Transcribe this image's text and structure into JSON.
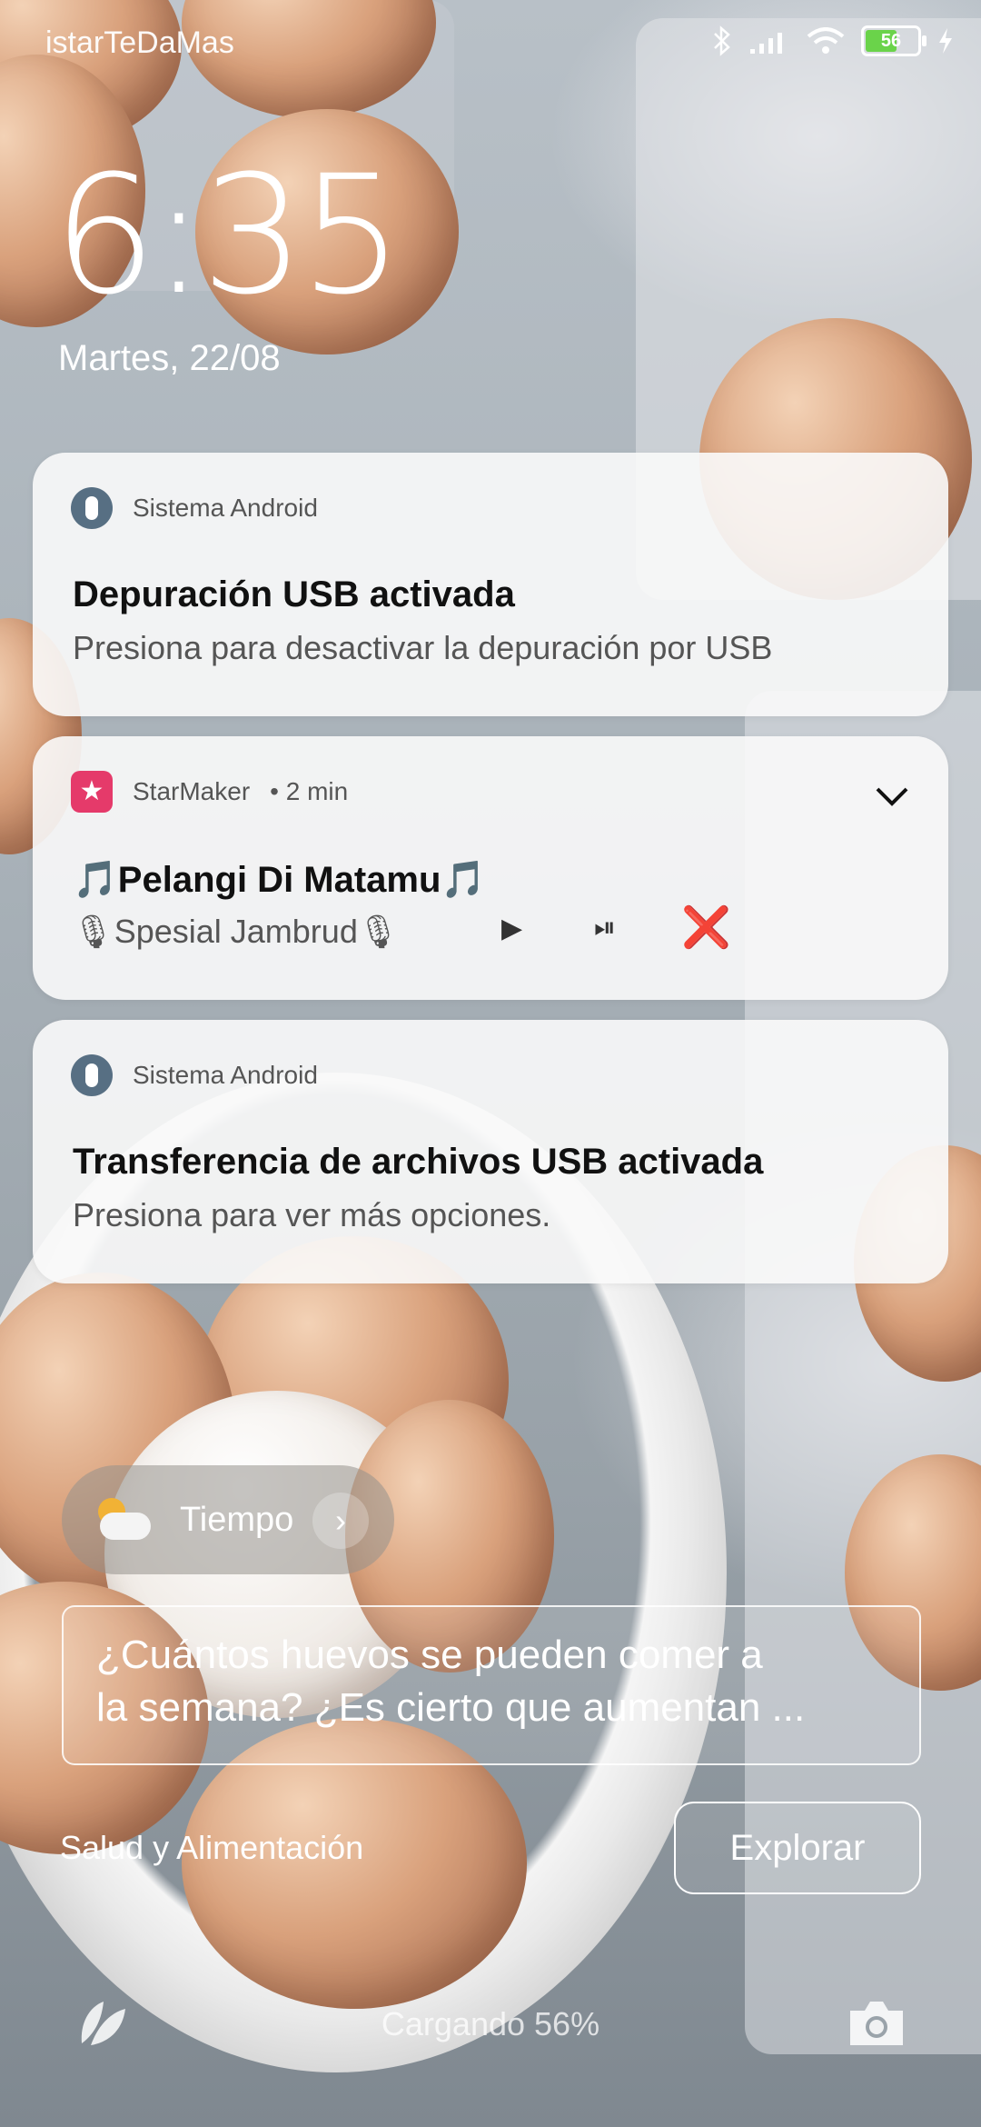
{
  "status_bar": {
    "carrier": "istarTeDaMas",
    "battery_level": "56",
    "icons": [
      "bluetooth-icon",
      "signal-icon",
      "wifi-icon",
      "battery-icon",
      "charging-bolt-icon"
    ]
  },
  "lock": {
    "time": "6:35",
    "date": "Martes, 22/08"
  },
  "notifications": [
    {
      "app": "Sistema Android",
      "title": "Depuración USB activada",
      "body": "Presiona para desactivar la depuración por USB"
    },
    {
      "app": "StarMaker",
      "time": "• 2 min",
      "title": "🎵Pelangi Di Matamu🎵",
      "body": "🎙Spesial Jambrud🎙",
      "controls": [
        "▶",
        "⏯",
        "❌"
      ]
    },
    {
      "app": "Sistema Android",
      "title": "Transferencia de archivos USB activada",
      "body": "Presiona para ver más opciones."
    }
  ],
  "weather": {
    "label": "Tiempo"
  },
  "article": {
    "line1": "¿Cuántos huevos se pueden comer a",
    "line2": "la semana? ¿Es cierto que aumentan ..."
  },
  "footer": {
    "category": "Salud y Alimentación",
    "explore_label": "Explorar",
    "charging": "Cargando 56%"
  },
  "colors": {
    "media_close": "#e0332c",
    "battery_fill": "#6ad34a",
    "android_icon": "#576f83",
    "starmaker_icon": "#e53a6a"
  }
}
